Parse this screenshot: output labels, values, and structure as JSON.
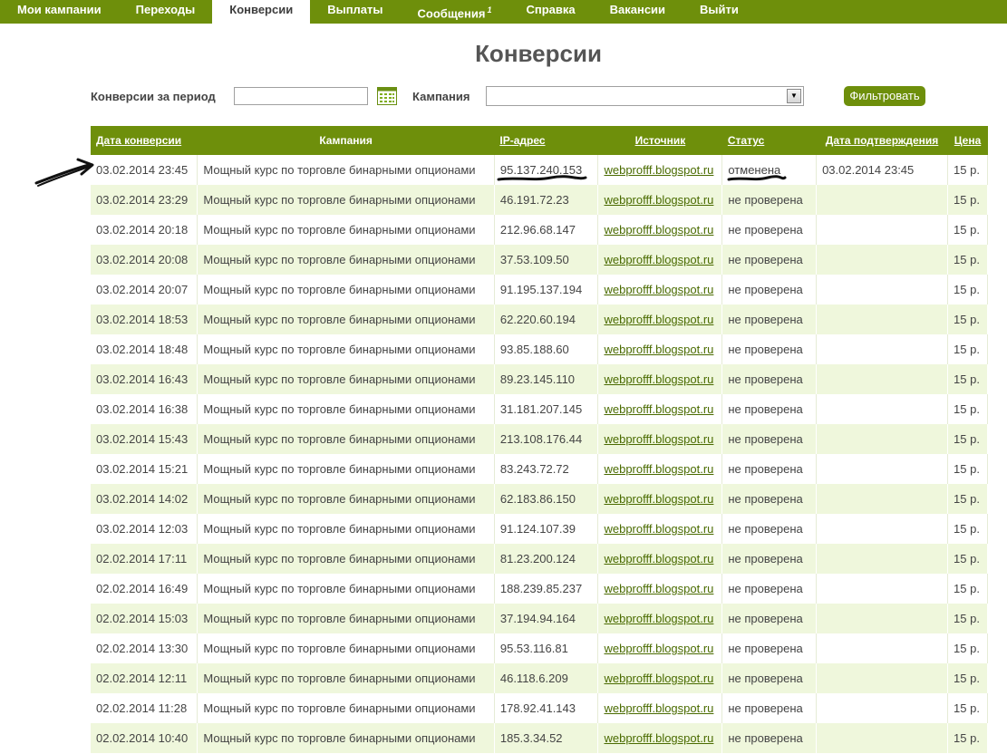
{
  "nav": {
    "items": [
      {
        "label": "Мои кампании",
        "active": false
      },
      {
        "label": "Переходы",
        "active": false
      },
      {
        "label": "Конверсии",
        "active": true
      },
      {
        "label": "Выплаты",
        "active": false
      },
      {
        "label": "Сообщения",
        "badge": "1",
        "active": false
      },
      {
        "label": "Справка",
        "active": false
      },
      {
        "label": "Вакансии",
        "active": false
      },
      {
        "label": "Выйти",
        "active": false
      }
    ]
  },
  "page_title": "Конверсии",
  "filter": {
    "period_label": "Конверсии за период",
    "period_value": "",
    "campaign_label": "Кампания",
    "campaign_value": "",
    "button_label": "Фильтровать"
  },
  "table": {
    "columns": [
      "Дата конверсии",
      "Кампания",
      "IP-адрес",
      "Источник",
      "Статус",
      "Дата подтверждения",
      "Цена"
    ],
    "rows": [
      [
        "03.02.2014 23:45",
        "Мощный курс по торговле бинарными опционами",
        "95.137.240.153",
        "webprofff.blogspot.ru",
        "отменена",
        "03.02.2014 23:45",
        "15 р."
      ],
      [
        "03.02.2014 23:29",
        "Мощный курс по торговле бинарными опционами",
        "46.191.72.23",
        "webprofff.blogspot.ru",
        "не проверена",
        "",
        "15 р."
      ],
      [
        "03.02.2014 20:18",
        "Мощный курс по торговле бинарными опционами",
        "212.96.68.147",
        "webprofff.blogspot.ru",
        "не проверена",
        "",
        "15 р."
      ],
      [
        "03.02.2014 20:08",
        "Мощный курс по торговле бинарными опционами",
        "37.53.109.50",
        "webprofff.blogspot.ru",
        "не проверена",
        "",
        "15 р."
      ],
      [
        "03.02.2014 20:07",
        "Мощный курс по торговле бинарными опционами",
        "91.195.137.194",
        "webprofff.blogspot.ru",
        "не проверена",
        "",
        "15 р."
      ],
      [
        "03.02.2014 18:53",
        "Мощный курс по торговле бинарными опционами",
        "62.220.60.194",
        "webprofff.blogspot.ru",
        "не проверена",
        "",
        "15 р."
      ],
      [
        "03.02.2014 18:48",
        "Мощный курс по торговле бинарными опционами",
        "93.85.188.60",
        "webprofff.blogspot.ru",
        "не проверена",
        "",
        "15 р."
      ],
      [
        "03.02.2014 16:43",
        "Мощный курс по торговле бинарными опционами",
        "89.23.145.110",
        "webprofff.blogspot.ru",
        "не проверена",
        "",
        "15 р."
      ],
      [
        "03.02.2014 16:38",
        "Мощный курс по торговле бинарными опционами",
        "31.181.207.145",
        "webprofff.blogspot.ru",
        "не проверена",
        "",
        "15 р."
      ],
      [
        "03.02.2014 15:43",
        "Мощный курс по торговле бинарными опционами",
        "213.108.176.44",
        "webprofff.blogspot.ru",
        "не проверена",
        "",
        "15 р."
      ],
      [
        "03.02.2014 15:21",
        "Мощный курс по торговле бинарными опционами",
        "83.243.72.72",
        "webprofff.blogspot.ru",
        "не проверена",
        "",
        "15 р."
      ],
      [
        "03.02.2014 14:02",
        "Мощный курс по торговле бинарными опционами",
        "62.183.86.150",
        "webprofff.blogspot.ru",
        "не проверена",
        "",
        "15 р."
      ],
      [
        "03.02.2014 12:03",
        "Мощный курс по торговле бинарными опционами",
        "91.124.107.39",
        "webprofff.blogspot.ru",
        "не проверена",
        "",
        "15 р."
      ],
      [
        "02.02.2014 17:11",
        "Мощный курс по торговле бинарными опционами",
        "81.23.200.124",
        "webprofff.blogspot.ru",
        "не проверена",
        "",
        "15 р."
      ],
      [
        "02.02.2014 16:49",
        "Мощный курс по торговле бинарными опционами",
        "188.239.85.237",
        "webprofff.blogspot.ru",
        "не проверена",
        "",
        "15 р."
      ],
      [
        "02.02.2014 15:03",
        "Мощный курс по торговле бинарными опционами",
        "37.194.94.164",
        "webprofff.blogspot.ru",
        "не проверена",
        "",
        "15 р."
      ],
      [
        "02.02.2014 13:30",
        "Мощный курс по торговле бинарными опционами",
        "95.53.116.81",
        "webprofff.blogspot.ru",
        "не проверена",
        "",
        "15 р."
      ],
      [
        "02.02.2014 12:11",
        "Мощный курс по торговле бинарными опционами",
        "46.118.6.209",
        "webprofff.blogspot.ru",
        "не проверена",
        "",
        "15 р."
      ],
      [
        "02.02.2014 11:28",
        "Мощный курс по торговле бинарными опционами",
        "178.92.41.143",
        "webprofff.blogspot.ru",
        "не проверена",
        "",
        "15 р."
      ],
      [
        "02.02.2014 10:40",
        "Мощный курс по торговле бинарными опционами",
        "185.3.34.52",
        "webprofff.blogspot.ru",
        "не проверена",
        "",
        "15 р."
      ]
    ]
  },
  "colors": {
    "accent": "#6e8f0b",
    "row_alt": "#eff7dc",
    "link": "#4a6b00"
  },
  "icons": {
    "calendar": "calendar-icon",
    "dropdown": "chevron-down-icon",
    "annotation": "arrow-annotation"
  }
}
